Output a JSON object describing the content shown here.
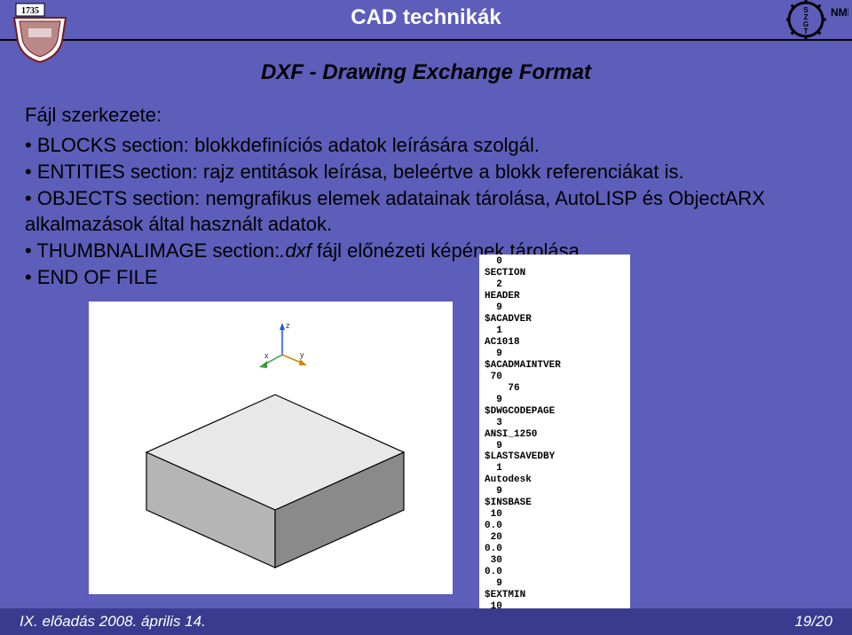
{
  "header": {
    "title": "CAD technikák",
    "logo_left_year": "1735",
    "logo_right_text": "NME",
    "logo_right_letters": [
      "S",
      "Z",
      "G",
      "T"
    ]
  },
  "subtitle": "DXF - Drawing Exchange Format",
  "content": {
    "heading": "Fájl szerkezete:",
    "bullets": [
      {
        "lead": "BLOCKS section:",
        "rest": " blokkdefiníciós adatok leírására szolgál."
      },
      {
        "lead": "ENTITIES section:",
        "rest": " rajz entitások leírása, beleértve a blokk referenciákat is."
      },
      {
        "lead": "OBJECTS section:",
        "rest": " nemgrafikus elemek adatainak tárolása, AutoLISP és ObjectARX alkalmazások által használt adatok."
      },
      {
        "lead": "THUMBNALIMAGE section:",
        "rest_italic": ".dxf ",
        "rest2": " fájl előnézeti képének tárolása"
      },
      {
        "lead": "END OF FILE",
        "rest": ""
      }
    ]
  },
  "dxf_text": "  0\nSECTION\n  2\nHEADER\n  9\n$ACADVER\n  1\nAC1018\n  9\n$ACADMAINTVER\n 70\n    76\n  9\n$DWGCODEPAGE\n  3\nANSI_1250\n  9\n$LASTSAVEDBY\n  1\nAutodesk\n  9\n$INSBASE\n 10\n0.0\n 20\n0.0\n 30\n0.0\n  9\n$EXTMIN\n 10",
  "axes": {
    "x": "x",
    "y": "y",
    "z": "z"
  },
  "footer": {
    "left": "IX. előadás 2008. április 14.",
    "right": "19/20"
  }
}
